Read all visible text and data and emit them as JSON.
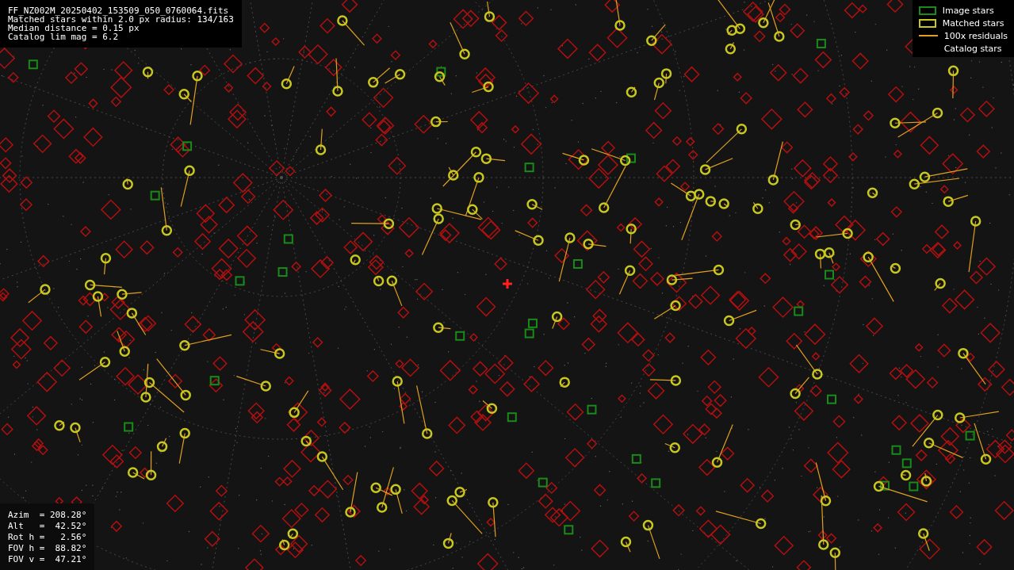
{
  "info": {
    "lines": [
      "FF_NZ002M_20250402_153509_050_0760064.fits",
      "Matched stars within 2.0 px radius: 134/163",
      "Median distance = 0.15 px",
      "Catalog lim mag = 6.2"
    ]
  },
  "legend": [
    {
      "kind": "box",
      "color": "#1a8a1a",
      "label": "Image stars"
    },
    {
      "kind": "box",
      "color": "#c8c820",
      "label": "Matched stars"
    },
    {
      "kind": "line",
      "color": "#e0a020",
      "label": "100x residuals"
    },
    {
      "kind": "none",
      "color": "#000000",
      "label": "Catalog stars"
    }
  ],
  "pointing": {
    "lines": [
      "Azim  = 208.28°",
      "Alt   =  42.52°",
      "Rot h =   2.56°",
      "FOV h =  88.82°",
      "FOV v =  47.21°"
    ]
  }
}
